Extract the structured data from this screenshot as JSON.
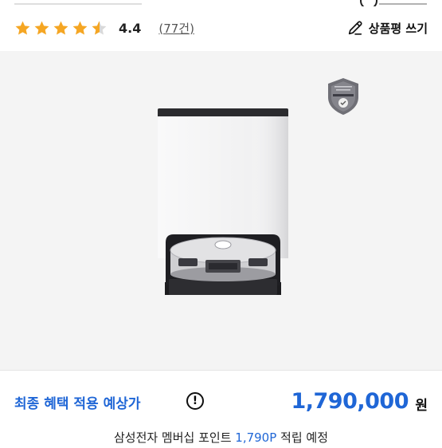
{
  "rating": {
    "stars": 4.4,
    "value": "4.4",
    "count": "(77건)",
    "star_color": "#f5a623"
  },
  "actions": {
    "write_review": "상품평 쓰기",
    "pencil_icon": "pencil-icon"
  },
  "gallery": {
    "badge_icon": "certification-shield-badge",
    "product_image": "robot-vacuum-with-cleaning-station"
  },
  "price": {
    "label": "최종 혜택 적용 예상가",
    "info_icon": "info-circle-icon",
    "amount": "1,790,000",
    "unit": "원",
    "accent": "#1f66d6"
  },
  "points": {
    "prefix": "삼성전자 멤버십 포인트 ",
    "amount": "1,790P",
    "suffix": " 적립 예정"
  }
}
